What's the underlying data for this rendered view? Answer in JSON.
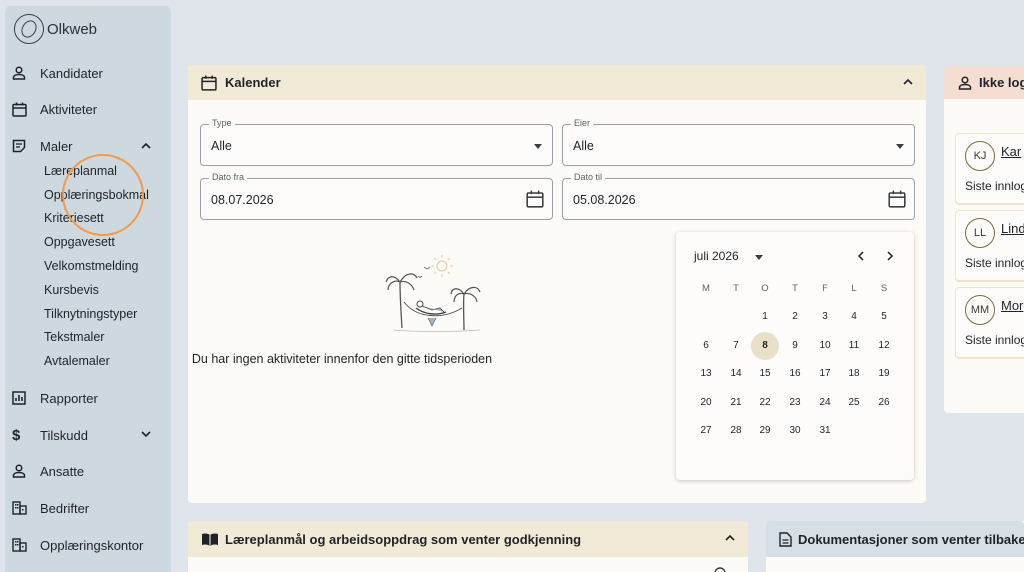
{
  "app": {
    "logo_text": "Olkweb"
  },
  "sidebar": {
    "items": [
      {
        "label": "Kandidater",
        "icon": "person-icon"
      },
      {
        "label": "Aktiviteter",
        "icon": "calendar-icon"
      },
      {
        "label": "Maler",
        "icon": "template-icon",
        "expanded": true
      },
      {
        "label": "Rapporter",
        "icon": "report-icon"
      },
      {
        "label": "Tilskudd",
        "icon": "dollar-icon",
        "expanded": false
      },
      {
        "label": "Ansatte",
        "icon": "person-icon"
      },
      {
        "label": "Bedrifter",
        "icon": "building-icon"
      },
      {
        "label": "Opplæringskontor",
        "icon": "building-icon"
      }
    ],
    "maler_sub": [
      "Læreplanmal",
      "Opplæringsbokmal",
      "Kriteriesett",
      "Oppgavesett",
      "Velkomstmelding",
      "Kursbevis",
      "Tilknytningstyper",
      "Tekstmaler",
      "Avtalemaler"
    ]
  },
  "calendar": {
    "title": "Kalender",
    "type": {
      "label": "Type",
      "value": "Alle"
    },
    "owner": {
      "label": "Eier",
      "value": "Alle"
    },
    "from": {
      "label": "Dato fra",
      "value": "08.07.2026"
    },
    "to": {
      "label": "Dato til",
      "value": "05.08.2026"
    },
    "empty_message": "Du har ingen aktiviteter innenfor den gitte tidsperioden",
    "picker": {
      "month": "juli 2026",
      "weekdays": [
        "M",
        "T",
        "O",
        "T",
        "F",
        "L",
        "S"
      ],
      "first_weekday_index": 2,
      "days_in_month": 31,
      "selected_day": 8
    }
  },
  "not_logged_in": {
    "title": "Ikke logget inn",
    "people": [
      {
        "initials": "KJ",
        "name": "Kar",
        "sub": "Siste innlogging"
      },
      {
        "initials": "LL",
        "name": "Lind",
        "sub": "Siste innlogging"
      },
      {
        "initials": "MM",
        "name": "Mor",
        "sub": "Siste innlogging"
      }
    ]
  },
  "approvals": {
    "title": "Læreplanmål og arbeidsoppdrag som venter godkjenning"
  },
  "documentation": {
    "title": "Dokumentasjoner som venter tilbakemelding"
  },
  "colors": {
    "accent_ring": "#f29a4a",
    "sidebar_bg": "#ced8df",
    "card_header": "#f1ead7"
  }
}
